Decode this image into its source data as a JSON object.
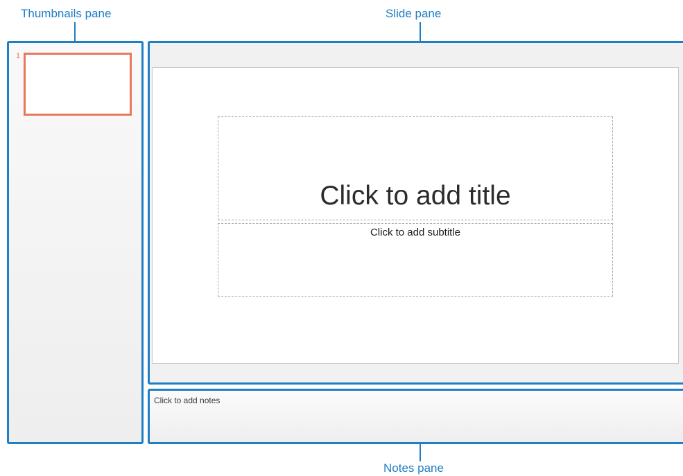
{
  "labels": {
    "thumbnails": "Thumbnails pane",
    "slide": "Slide pane",
    "notes": "Notes pane"
  },
  "thumbnails": {
    "items": [
      {
        "number": "1"
      }
    ]
  },
  "slide": {
    "title_placeholder": "Click to add title",
    "subtitle_placeholder": "Click to add subtitle"
  },
  "notes": {
    "placeholder": "Click to add notes"
  },
  "colors": {
    "callout_blue": "#1f7fc4",
    "selected_thumbnail": "#e8785d"
  }
}
